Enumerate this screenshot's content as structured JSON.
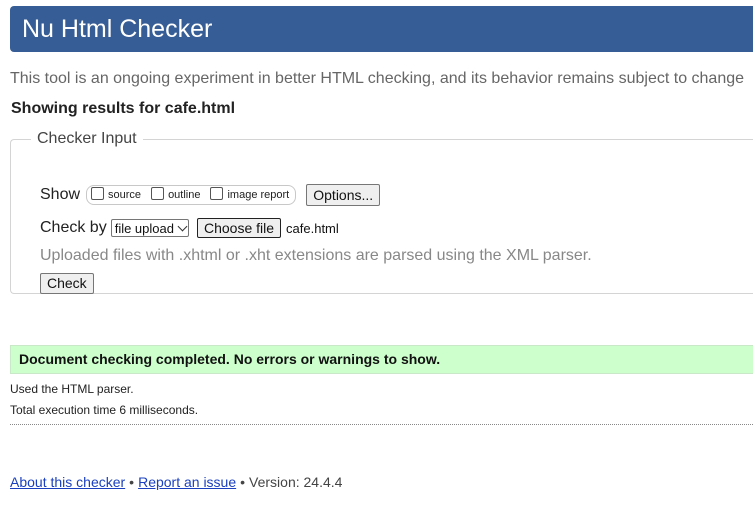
{
  "header": {
    "title": "Nu Html Checker"
  },
  "tagline": "This tool is an ongoing experiment in better HTML checking, and its behavior remains subject to change",
  "results_for": "Showing results for cafe.html",
  "checker_input": {
    "legend": "Checker Input",
    "show_label": "Show",
    "show_options": [
      "source",
      "outline",
      "image report"
    ],
    "options_button": "Options...",
    "check_by_label": "Check by",
    "check_by_value": "file upload",
    "choose_file_button": "Choose file",
    "file_name": "cafe.html",
    "note": "Uploaded files with .xhtml or .xht extensions are parsed using the XML parser.",
    "check_button": "Check"
  },
  "result": {
    "message": "Document checking completed. No errors or warnings to show.",
    "parser": "Used the HTML parser.",
    "time": "Total execution time 6 milliseconds."
  },
  "footer": {
    "about_link": "About this checker",
    "separator": "•",
    "report_link": "Report an issue",
    "version": "Version: 24.4.4"
  },
  "colors": {
    "header_bg": "#365d95",
    "success_bg": "#ccffcc",
    "link": "#1a3fbf"
  }
}
